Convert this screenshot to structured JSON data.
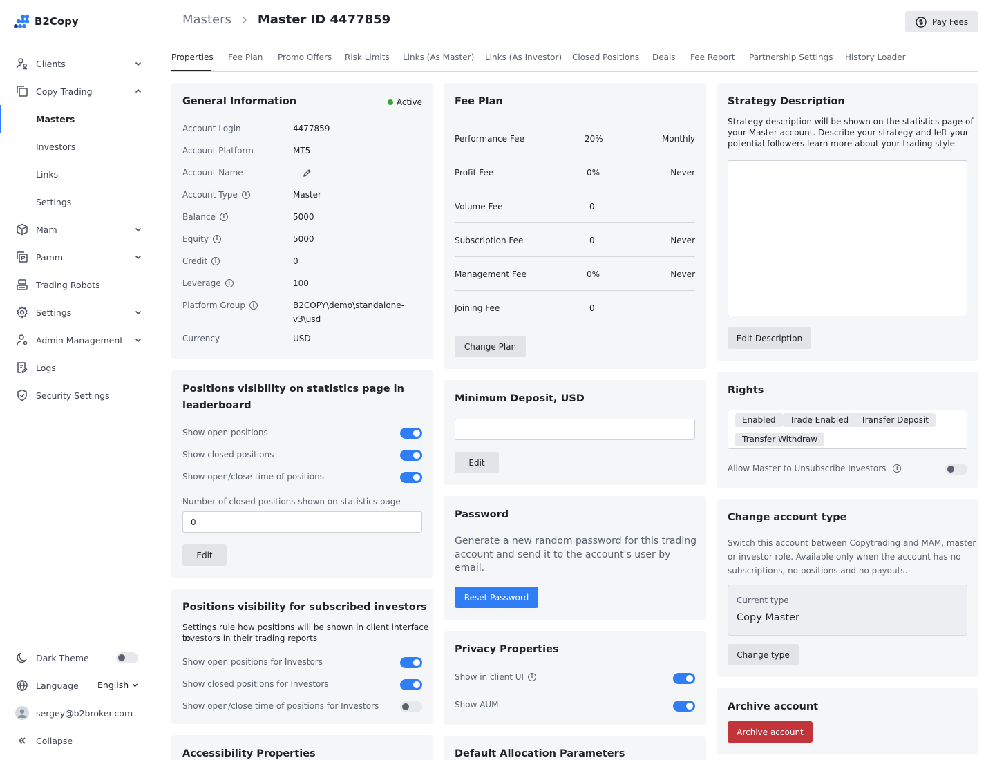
{
  "app": {
    "name": "B2Copy"
  },
  "sidebar": {
    "items": [
      {
        "label": "Clients",
        "icon": "clients-icon",
        "expandable": true
      },
      {
        "label": "Copy Trading",
        "icon": "copy-icon",
        "expandable": true,
        "expanded": true
      },
      {
        "label": "Mam",
        "icon": "cube-icon",
        "expandable": true
      },
      {
        "label": "Pamm",
        "icon": "pamm-icon",
        "expandable": true
      },
      {
        "label": "Trading Robots",
        "icon": "robot-icon",
        "expandable": false
      },
      {
        "label": "Settings",
        "icon": "gear-icon",
        "expandable": true
      },
      {
        "label": "Admin Management",
        "icon": "admin-icon",
        "expandable": true
      },
      {
        "label": "Logs",
        "icon": "logs-icon",
        "expandable": false
      },
      {
        "label": "Security Settings",
        "icon": "shield-icon",
        "expandable": false
      }
    ],
    "copy_trading_sub": [
      "Masters",
      "Investors",
      "Links",
      "Settings"
    ],
    "footer": {
      "dark_theme_label": "Dark Theme",
      "dark_theme_on": false,
      "language_label": "Language",
      "language_value": "English",
      "user_email": "sergey@b2broker.com",
      "collapse_label": "Collapse"
    }
  },
  "header": {
    "breadcrumb_parent": "Masters",
    "breadcrumb_current": "Master ID 4477859",
    "pay_fees_label": "Pay Fees"
  },
  "tabs": [
    "Properties",
    "Fee Plan",
    "Promo Offers",
    "Risk Limits",
    "Links (As Master)",
    "Links (As Investor)",
    "Closed Positions",
    "Deals",
    "Fee Report",
    "Partnership Settings",
    "History Loader"
  ],
  "general": {
    "title": "General Information",
    "status": "Active",
    "status_color": "#3aa335",
    "rows": [
      {
        "label": "Account Login",
        "value": "4477859"
      },
      {
        "label": "Account Platform",
        "value": "MT5"
      },
      {
        "label": "Account Name",
        "value": "-"
      },
      {
        "label": "Account Type",
        "value": "Master"
      },
      {
        "label": "Balance",
        "value": "5000"
      },
      {
        "label": "Equity",
        "value": "5000"
      },
      {
        "label": "Credit",
        "value": "0"
      },
      {
        "label": "Leverage",
        "value": "100"
      },
      {
        "label": "Platform Group",
        "value_line1": "B2COPY\\demo\\standalone-",
        "value_line2": "v3\\usd"
      },
      {
        "label": "Currency",
        "value": "USD"
      }
    ]
  },
  "positions_visibility": {
    "title_line1": "Positions visibility on statistics page in",
    "title_line2": "leaderboard",
    "toggles": [
      {
        "label": "Show open positions",
        "on": true
      },
      {
        "label": "Show closed positions",
        "on": true
      },
      {
        "label": "Show open/close time of positions",
        "on": true
      }
    ],
    "count_label": "Number of closed positions shown on statistics page",
    "count_value": "0",
    "edit_label": "Edit"
  },
  "investors_visibility": {
    "title": "Positions visibility for subscribed investors",
    "desc_line1": "Settings rule how positions will be shown in client interface to",
    "desc_line2": "investors in their trading reports",
    "toggles": [
      {
        "label": "Show open positions for Investors",
        "on": true
      },
      {
        "label": "Show closed positions for Investors",
        "on": true
      },
      {
        "label": "Show open/close time of positions for Investors",
        "on": false
      }
    ]
  },
  "accessibility": {
    "title": "Accessibility Properties"
  },
  "fee_plan": {
    "title": "Fee Plan",
    "rows": [
      {
        "name": "Performance Fee",
        "value": "20%",
        "period": "Monthly"
      },
      {
        "name": "Profit Fee",
        "value": "0%",
        "period": "Never"
      },
      {
        "name": "Volume Fee",
        "value": "0",
        "period": ""
      },
      {
        "name": "Subscription Fee",
        "value": "0",
        "period": "Never"
      },
      {
        "name": "Management Fee",
        "value": "0%",
        "period": "Never"
      },
      {
        "name": "Joining Fee",
        "value": "0",
        "period": ""
      }
    ],
    "change_label": "Change Plan"
  },
  "min_deposit": {
    "title": "Minimum Deposit, USD",
    "value": "",
    "edit_label": "Edit"
  },
  "password": {
    "title": "Password",
    "desc_line1": "Generate a new random password for this trading",
    "desc_line2": "account and send it to the account's user by",
    "desc_line3": "email.",
    "button": "Reset Password"
  },
  "privacy": {
    "title": "Privacy Properties",
    "toggles": [
      {
        "label": "Show in client UI",
        "on": true
      },
      {
        "label": "Show AUM",
        "on": true
      }
    ]
  },
  "allocation": {
    "title": "Default Allocation Parameters"
  },
  "strategy": {
    "title": "Strategy Description",
    "desc_line1": "Strategy description will be shown on the statistics page of",
    "desc_line2": "your Master account. Describe your strategy and left your",
    "desc_line3": "potential followers learn more about your trading style",
    "value": "",
    "edit_label": "Edit Description"
  },
  "rights": {
    "title": "Rights",
    "tags": [
      "Enabled",
      "Trade Enabled",
      "Transfer Deposit",
      "Transfer Withdraw"
    ],
    "allow_label": "Allow Master to Unsubscribe Investors",
    "allow_on": false
  },
  "change_type": {
    "title": "Change account type",
    "desc_line1": "Switch this account between Copytrading and MAM, master",
    "desc_line2": "or investor role. Available only when the account has no",
    "desc_line3": "subscriptions, no positions and no payouts.",
    "current_label": "Current type",
    "current_value": "Copy Master",
    "button": "Change type"
  },
  "archive": {
    "title": "Archive account",
    "button": "Archive account"
  }
}
